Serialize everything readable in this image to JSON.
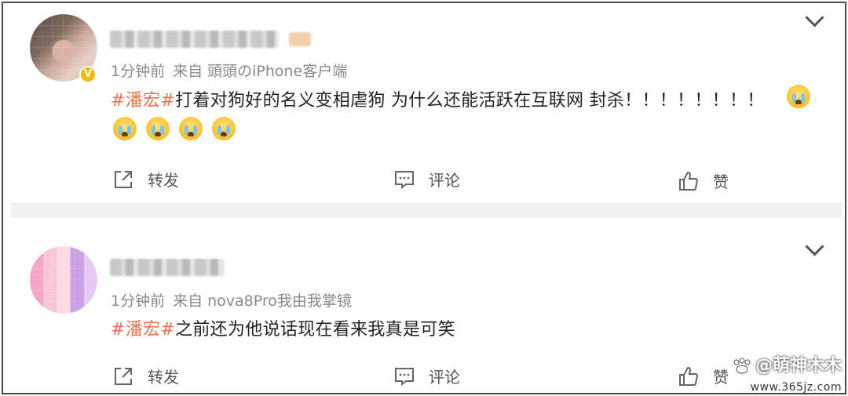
{
  "posts": [
    {
      "meta": {
        "time": "1分钟前",
        "source_prefix": "来自",
        "source": "頭頭のiPhone客户端"
      },
      "verified_badge": "V",
      "content": {
        "hashtag": "#潘宏#",
        "text": "打着对狗好的名义变相虐狗 为什么还能活跃在互联网 封杀！！！！！！！！"
      },
      "emojis": [
        "crying-emoji",
        "crying-emoji",
        "crying-emoji",
        "crying-emoji",
        "crying-emoji"
      ],
      "actions": {
        "forward": "转发",
        "comment": "评论",
        "like": "赞"
      }
    },
    {
      "meta": {
        "time": "1分钟前",
        "source_prefix": "来自",
        "source": "nova8Pro我由我掌镜"
      },
      "content": {
        "hashtag": "#潘宏#",
        "text": "之前还为他说话现在看来我真是可笑"
      },
      "actions": {
        "forward": "转发",
        "comment": "评论",
        "like": "赞"
      }
    }
  ],
  "watermark": {
    "line1": "@萌神木木",
    "line2": "www.365jz.com"
  },
  "colors": {
    "hashtag": "#eb7350",
    "meta": "#8a8a8a",
    "verified": "#f5b800",
    "divider": "#f1f1f1"
  }
}
